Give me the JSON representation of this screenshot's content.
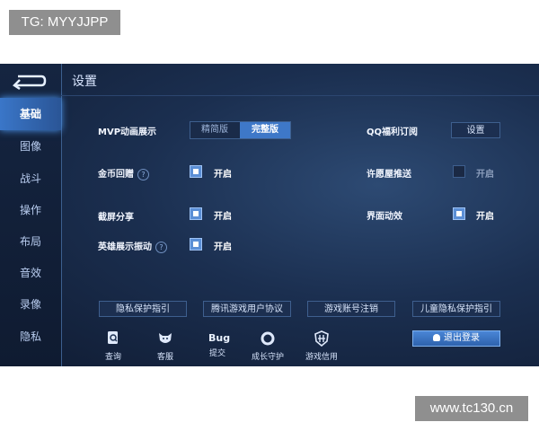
{
  "watermarks": {
    "top": "TG: MYYJJPP",
    "bottom": "www.tc130.cn"
  },
  "header": {
    "title": "设置"
  },
  "sidebar": {
    "items": [
      {
        "label": "基础",
        "active": true
      },
      {
        "label": "图像"
      },
      {
        "label": "战斗"
      },
      {
        "label": "操作"
      },
      {
        "label": "布局"
      },
      {
        "label": "音效"
      },
      {
        "label": "录像"
      },
      {
        "label": "隐私"
      }
    ]
  },
  "settings": {
    "mvp": {
      "label": "MVP动画展示",
      "options": [
        "精简版",
        "完整版"
      ],
      "selected": "完整版"
    },
    "qq": {
      "label": "QQ福利订阅",
      "button": "设置"
    },
    "coin": {
      "label": "金币回赠",
      "state_label": "开启",
      "checked": true
    },
    "wish": {
      "label": "许愿屋推送",
      "state_label": "开启",
      "checked": false
    },
    "screenshot": {
      "label": "截屏分享",
      "state_label": "开启",
      "checked": true
    },
    "ui_anim": {
      "label": "界面动效",
      "state_label": "开启",
      "checked": true
    },
    "hero_vibe": {
      "label": "英雄展示振动",
      "state_label": "开启",
      "checked": true
    }
  },
  "links": [
    "隐私保护指引",
    "腾讯游戏用户协议",
    "游戏账号注销",
    "儿童隐私保护指引"
  ],
  "bottom_icons": [
    {
      "label": "查询",
      "icon": "search-doc-icon"
    },
    {
      "label": "客服",
      "icon": "support-icon"
    },
    {
      "label": "提交",
      "icon": "bug-icon",
      "glyph": "Bug"
    },
    {
      "label": "成长守护",
      "icon": "guardian-ring-icon"
    },
    {
      "label": "游戏信用",
      "icon": "credit-shield-icon"
    }
  ],
  "logout": {
    "label": "退出登录"
  },
  "colors": {
    "accent": "#3e78c8",
    "background": "#1b2f50",
    "checkbox": "#5b8fd6"
  }
}
